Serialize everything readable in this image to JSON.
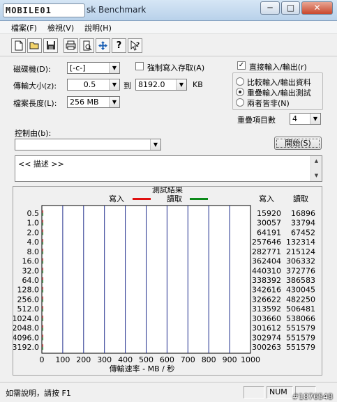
{
  "window": {
    "logo_text": "MOBILE01",
    "title": "sk Benchmark",
    "min_glyph": "─",
    "max_glyph": "□",
    "close_glyph": "✕"
  },
  "menu": [
    "檔案(F)",
    "檢視(V)",
    "說明(H)"
  ],
  "toolbar": {
    "icons": [
      "new-file-icon",
      "open-folder-icon",
      "save-icon",
      "print-icon",
      "print-preview-icon",
      "move-arrows-icon",
      "help-icon",
      "context-help-icon"
    ]
  },
  "settings": {
    "drive_label": "磁碟機(D):",
    "drive_value": "[-c-]",
    "force_write_label": "強制寫入存取(A)",
    "force_write_checked": false,
    "transfer_size_label": "傳輸大小(z):",
    "transfer_from": "0.5",
    "to_label": "到",
    "transfer_to": "8192.0",
    "unit_kb": "KB",
    "file_length_label": "檔案長度(L):",
    "file_length_value": "256 MB",
    "direct_io_label": "直接輸入/輸出(r)",
    "direct_io_checked": true,
    "radio_options": [
      "比較輸入/輸出資料",
      "重疊輸入/輸出測試",
      "兩者皆非(N)"
    ],
    "radio_selected": 1,
    "queue_depth_label": "重疊項目數",
    "queue_depth_value": "4",
    "controlled_by_label": "控制由(b):",
    "controlled_by_value": "",
    "start_button": "開始(S)",
    "description_text": "<<    描述    >>"
  },
  "chart_data": {
    "type": "bar",
    "title": "測試結果",
    "orientation": "horizontal",
    "categories": [
      "0.5",
      "1.0",
      "2.0",
      "4.0",
      "8.0",
      "16.0",
      "32.0",
      "64.0",
      "128.0",
      "256.0",
      "512.0",
      "1024.0",
      "2048.0",
      "4096.0",
      "3192.0"
    ],
    "series": [
      {
        "name": "寫入",
        "color": "#e01010",
        "values": [
          15920,
          30057,
          64191,
          257646,
          282771,
          362404,
          440310,
          338392,
          342616,
          326622,
          313592,
          303660,
          301612,
          302974,
          300263
        ]
      },
      {
        "name": "讀取",
        "color": "#0c8a1a",
        "values": [
          16896,
          33794,
          67452,
          132314,
          215124,
          306332,
          372776,
          386583,
          430045,
          482250,
          506481,
          538066,
          551579,
          551579,
          551579
        ]
      }
    ],
    "col_write_header": "寫入",
    "col_read_header": "讀取",
    "xlabel": "傳輸速率 - MB / 秒",
    "xticks": [
      "0",
      "100",
      "200",
      "300",
      "400",
      "500",
      "600",
      "700",
      "800",
      "900",
      "1000"
    ],
    "xlim": [
      0,
      1000
    ],
    "grid": true,
    "legend_position": "top"
  },
  "status": {
    "help_text": "如需說明，請按 F1",
    "num": "NUM",
    "watermark": "#1876548"
  }
}
